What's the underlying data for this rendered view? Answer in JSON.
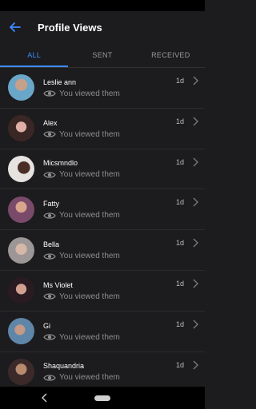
{
  "header": {
    "title": "Profile Views"
  },
  "tabs": [
    {
      "label": "ALL"
    },
    {
      "label": "SENT"
    },
    {
      "label": "RECEIVED"
    }
  ],
  "rows": [
    {
      "name": "Leslie ann",
      "status": "You viewed them",
      "time": "1d",
      "avatar_color": "#6aa6c8"
    },
    {
      "name": "Alex",
      "status": "You viewed them",
      "time": "1d",
      "avatar_color": "#c98a86"
    },
    {
      "name": "Micsmndlo",
      "status": "You viewed them",
      "time": "1d",
      "avatar_color": "#d8d4d2"
    },
    {
      "name": "Fatty",
      "status": "You viewed them",
      "time": "1d",
      "avatar_color": "#b8869a"
    },
    {
      "name": "Bella",
      "status": "You viewed them",
      "time": "1d",
      "avatar_color": "#a9a4a4"
    },
    {
      "name": "Ms Violet",
      "status": "You viewed them",
      "time": "1d",
      "avatar_color": "#5a3c4a"
    },
    {
      "name": "Gi",
      "status": "You viewed them",
      "time": "1d",
      "avatar_color": "#6c8fb0"
    },
    {
      "name": "Shaquandria",
      "status": "You viewed them",
      "time": "1d",
      "avatar_color": "#8a6a5a"
    }
  ],
  "colors": {
    "accent": "#3d8bff",
    "background": "#1c1c1e"
  }
}
